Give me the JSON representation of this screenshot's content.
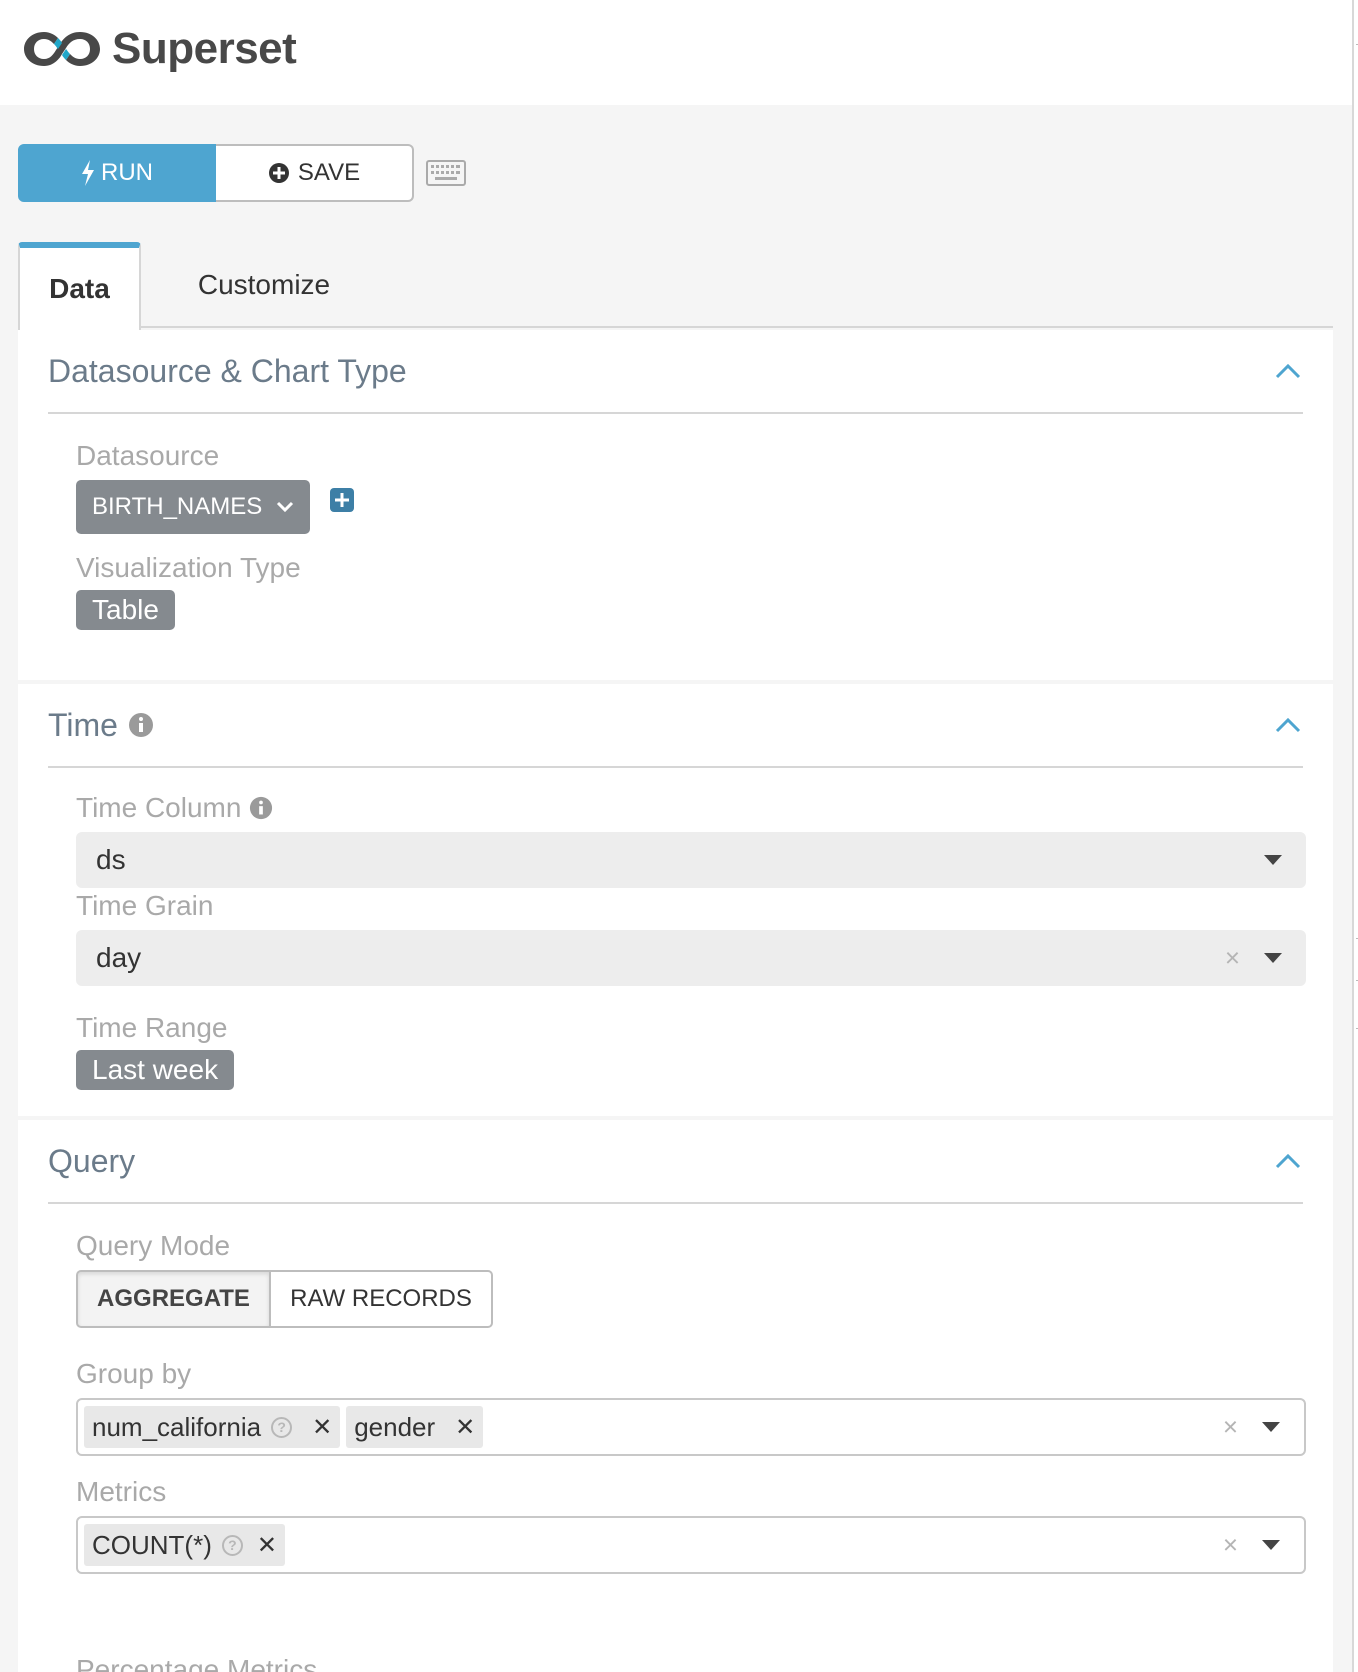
{
  "app": {
    "name": "Superset"
  },
  "toolbar": {
    "run_label": "RUN",
    "save_label": "SAVE"
  },
  "tabs": [
    {
      "label": "Data",
      "active": true
    },
    {
      "label": "Customize",
      "active": false
    }
  ],
  "sections": {
    "datasource": {
      "title": "Datasource & Chart Type",
      "datasource_label": "Datasource",
      "datasource_value": "BIRTH_NAMES",
      "viz_label": "Visualization Type",
      "viz_value": "Table"
    },
    "time": {
      "title": "Time",
      "time_column_label": "Time Column",
      "time_column_value": "ds",
      "time_grain_label": "Time Grain",
      "time_grain_value": "day",
      "time_range_label": "Time Range",
      "time_range_value": "Last week"
    },
    "query": {
      "title": "Query",
      "query_mode_label": "Query Mode",
      "modes": [
        "AGGREGATE",
        "RAW RECORDS"
      ],
      "active_mode": "AGGREGATE",
      "group_by_label": "Group by",
      "group_by_tags": [
        "num_california",
        "gender"
      ],
      "metrics_label": "Metrics",
      "metrics_tags": [
        "COUNT(*)"
      ],
      "next_label": "Percentage Metrics"
    }
  },
  "colors": {
    "accent": "#4ea5d0",
    "pill": "#858a8f",
    "section_title": "#6b7b8a",
    "label": "#a9a9a9"
  }
}
